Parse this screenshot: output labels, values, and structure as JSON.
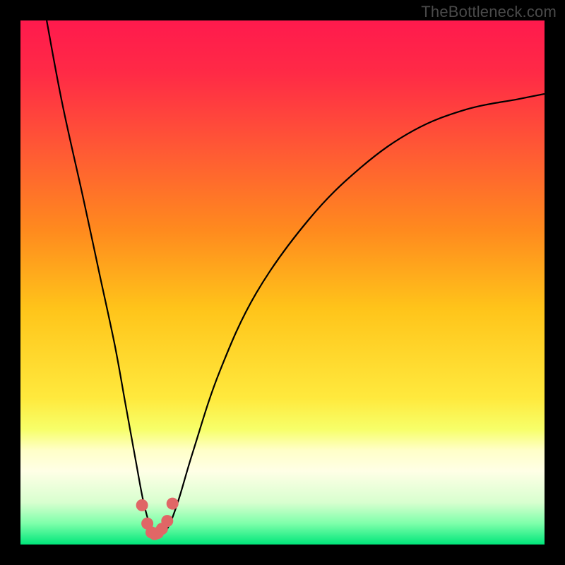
{
  "watermark": {
    "text": "TheBottleneck.com"
  },
  "colors": {
    "bg": "#000000",
    "gradient_stops": [
      {
        "offset": 0.0,
        "color": "#ff1a4d"
      },
      {
        "offset": 0.1,
        "color": "#ff2a46"
      },
      {
        "offset": 0.25,
        "color": "#ff5a34"
      },
      {
        "offset": 0.4,
        "color": "#ff8a1e"
      },
      {
        "offset": 0.55,
        "color": "#ffc41a"
      },
      {
        "offset": 0.72,
        "color": "#ffe93d"
      },
      {
        "offset": 0.78,
        "color": "#f7ff69"
      },
      {
        "offset": 0.82,
        "color": "#ffffc8"
      },
      {
        "offset": 0.86,
        "color": "#ffffe6"
      },
      {
        "offset": 0.92,
        "color": "#d8ffcf"
      },
      {
        "offset": 0.96,
        "color": "#7dffaa"
      },
      {
        "offset": 1.0,
        "color": "#00e67a"
      }
    ],
    "curve": "#000000",
    "marker_fill": "#e06666",
    "marker_stroke": "#e06666"
  },
  "chart_data": {
    "type": "line",
    "title": "",
    "xlabel": "",
    "ylabel": "",
    "xlim": [
      0,
      100
    ],
    "ylim": [
      0,
      100
    ],
    "series": [
      {
        "name": "bottleneck-curve",
        "x": [
          5,
          8,
          12,
          15,
          18,
          20,
          22,
          23.5,
          25,
          26.5,
          28,
          30,
          33,
          38,
          45,
          55,
          65,
          75,
          85,
          95,
          100
        ],
        "y": [
          100,
          84,
          66,
          52,
          38,
          27,
          16,
          8,
          3,
          2,
          3,
          8,
          18,
          33,
          48,
          62,
          72,
          79,
          83,
          85,
          86
        ]
      }
    ],
    "markers": {
      "name": "highlight-points",
      "x": [
        23.2,
        24.2,
        25.0,
        25.6,
        26.2,
        27.0,
        28.0,
        29.0
      ],
      "y": [
        7.5,
        4.0,
        2.3,
        2.0,
        2.2,
        3.0,
        4.5,
        7.8
      ]
    }
  }
}
